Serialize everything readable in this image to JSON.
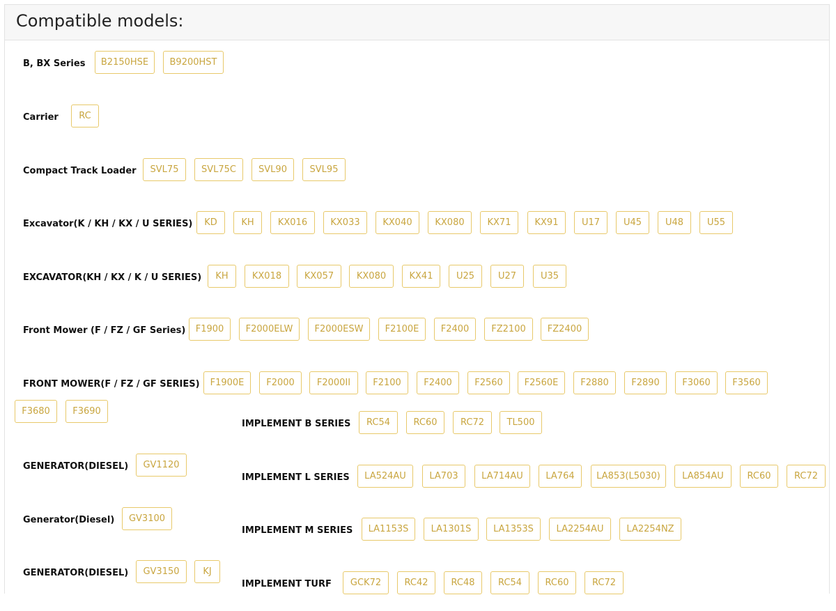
{
  "header": {
    "title": "Compatible models:"
  },
  "groups": [
    {
      "label": "B, BX Series",
      "models": [
        "B2150HSE",
        "B9200HST"
      ]
    },
    {
      "label": "Carrier",
      "models": [
        "RC"
      ]
    },
    {
      "label": "Compact Track Loader",
      "models": [
        "SVL75",
        "SVL75C",
        "SVL90",
        "SVL95"
      ]
    },
    {
      "label": "Excavator(K / KH / KX / U SERIES)",
      "models": [
        "KD",
        "KH",
        "KX016",
        "KX033",
        "KX040",
        "KX080",
        "KX71",
        "KX91",
        "U17",
        "U45",
        "U48",
        "U55"
      ]
    },
    {
      "label": "EXCAVATOR(KH / KX / K / U SERIES)",
      "models": [
        "KH",
        "KX018",
        "KX057",
        "KX080",
        "KX41",
        "U25",
        "U27",
        "U35"
      ]
    },
    {
      "label": "Front Mower (F / FZ / GF Series)",
      "models": [
        "F1900",
        "F2000ELW",
        "F2000ESW",
        "F2100E",
        "F2400",
        "FZ2100",
        "FZ2400"
      ]
    },
    {
      "label": "FRONT MOWER(F / FZ / GF SERIES)",
      "models": [
        "F1900E",
        "F2000",
        "F2000II",
        "F2100",
        "F2400",
        "F2560",
        "F2560E",
        "F2880",
        "F2890",
        "F3060",
        "F3560",
        "F3680",
        "F3690"
      ]
    },
    {
      "label": "GENERATOR(DIESEL)",
      "models": [
        "GV1120"
      ]
    },
    {
      "label": "Generator(Diesel)",
      "models": [
        "GV3100"
      ]
    },
    {
      "label": "GENERATOR(DIESEL)",
      "models": [
        "GV3150",
        "KJ"
      ]
    },
    {
      "label": "IMPLEMENT B SERIES",
      "models": [
        "RC54",
        "RC60",
        "RC72",
        "TL500"
      ]
    },
    {
      "label": "IMPLEMENT L SERIES",
      "models": [
        "LA524AU",
        "LA703",
        "LA714AU",
        "LA764",
        "LA853(L5030)",
        "LA854AU",
        "RC60",
        "RC72"
      ]
    },
    {
      "label": "IMPLEMENT M SERIES",
      "models": [
        "LA1153S",
        "LA1301S",
        "LA1353S",
        "LA2254AU",
        "LA2254NZ"
      ]
    },
    {
      "label": "IMPLEMENT TURF",
      "models": [
        "GCK72",
        "RC42",
        "RC48",
        "RC54",
        "RC60",
        "RC72"
      ]
    }
  ]
}
